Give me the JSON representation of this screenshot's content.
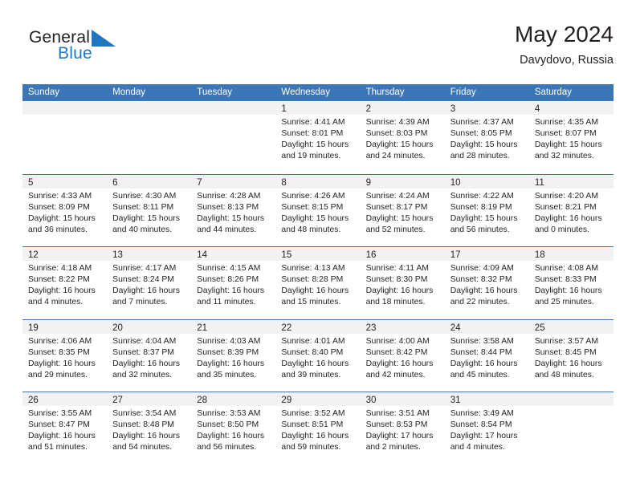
{
  "brand": {
    "line1": "General",
    "line2": "Blue",
    "mark": "triangle-logo"
  },
  "header": {
    "title": "May 2024",
    "subtitle": "Davydovo, Russia"
  },
  "colors": {
    "header_blue": "#3a76b8",
    "brand_blue": "#2077c0",
    "daynum_band": "#f2f2f2",
    "text": "#231f20"
  },
  "weekdays": [
    "Sunday",
    "Monday",
    "Tuesday",
    "Wednesday",
    "Thursday",
    "Friday",
    "Saturday"
  ],
  "weeks": [
    [
      {
        "empty": true
      },
      {
        "empty": true
      },
      {
        "empty": true
      },
      {
        "day": "1",
        "sunrise": "Sunrise: 4:41 AM",
        "sunset": "Sunset: 8:01 PM",
        "daylight1": "Daylight: 15 hours",
        "daylight2": "and 19 minutes."
      },
      {
        "day": "2",
        "sunrise": "Sunrise: 4:39 AM",
        "sunset": "Sunset: 8:03 PM",
        "daylight1": "Daylight: 15 hours",
        "daylight2": "and 24 minutes."
      },
      {
        "day": "3",
        "sunrise": "Sunrise: 4:37 AM",
        "sunset": "Sunset: 8:05 PM",
        "daylight1": "Daylight: 15 hours",
        "daylight2": "and 28 minutes."
      },
      {
        "day": "4",
        "sunrise": "Sunrise: 4:35 AM",
        "sunset": "Sunset: 8:07 PM",
        "daylight1": "Daylight: 15 hours",
        "daylight2": "and 32 minutes."
      }
    ],
    [
      {
        "day": "5",
        "sunrise": "Sunrise: 4:33 AM",
        "sunset": "Sunset: 8:09 PM",
        "daylight1": "Daylight: 15 hours",
        "daylight2": "and 36 minutes."
      },
      {
        "day": "6",
        "sunrise": "Sunrise: 4:30 AM",
        "sunset": "Sunset: 8:11 PM",
        "daylight1": "Daylight: 15 hours",
        "daylight2": "and 40 minutes."
      },
      {
        "day": "7",
        "sunrise": "Sunrise: 4:28 AM",
        "sunset": "Sunset: 8:13 PM",
        "daylight1": "Daylight: 15 hours",
        "daylight2": "and 44 minutes."
      },
      {
        "day": "8",
        "sunrise": "Sunrise: 4:26 AM",
        "sunset": "Sunset: 8:15 PM",
        "daylight1": "Daylight: 15 hours",
        "daylight2": "and 48 minutes."
      },
      {
        "day": "9",
        "sunrise": "Sunrise: 4:24 AM",
        "sunset": "Sunset: 8:17 PM",
        "daylight1": "Daylight: 15 hours",
        "daylight2": "and 52 minutes."
      },
      {
        "day": "10",
        "sunrise": "Sunrise: 4:22 AM",
        "sunset": "Sunset: 8:19 PM",
        "daylight1": "Daylight: 15 hours",
        "daylight2": "and 56 minutes."
      },
      {
        "day": "11",
        "sunrise": "Sunrise: 4:20 AM",
        "sunset": "Sunset: 8:21 PM",
        "daylight1": "Daylight: 16 hours",
        "daylight2": "and 0 minutes."
      }
    ],
    [
      {
        "day": "12",
        "sunrise": "Sunrise: 4:18 AM",
        "sunset": "Sunset: 8:22 PM",
        "daylight1": "Daylight: 16 hours",
        "daylight2": "and 4 minutes."
      },
      {
        "day": "13",
        "sunrise": "Sunrise: 4:17 AM",
        "sunset": "Sunset: 8:24 PM",
        "daylight1": "Daylight: 16 hours",
        "daylight2": "and 7 minutes."
      },
      {
        "day": "14",
        "sunrise": "Sunrise: 4:15 AM",
        "sunset": "Sunset: 8:26 PM",
        "daylight1": "Daylight: 16 hours",
        "daylight2": "and 11 minutes."
      },
      {
        "day": "15",
        "sunrise": "Sunrise: 4:13 AM",
        "sunset": "Sunset: 8:28 PM",
        "daylight1": "Daylight: 16 hours",
        "daylight2": "and 15 minutes."
      },
      {
        "day": "16",
        "sunrise": "Sunrise: 4:11 AM",
        "sunset": "Sunset: 8:30 PM",
        "daylight1": "Daylight: 16 hours",
        "daylight2": "and 18 minutes."
      },
      {
        "day": "17",
        "sunrise": "Sunrise: 4:09 AM",
        "sunset": "Sunset: 8:32 PM",
        "daylight1": "Daylight: 16 hours",
        "daylight2": "and 22 minutes."
      },
      {
        "day": "18",
        "sunrise": "Sunrise: 4:08 AM",
        "sunset": "Sunset: 8:33 PM",
        "daylight1": "Daylight: 16 hours",
        "daylight2": "and 25 minutes."
      }
    ],
    [
      {
        "day": "19",
        "sunrise": "Sunrise: 4:06 AM",
        "sunset": "Sunset: 8:35 PM",
        "daylight1": "Daylight: 16 hours",
        "daylight2": "and 29 minutes."
      },
      {
        "day": "20",
        "sunrise": "Sunrise: 4:04 AM",
        "sunset": "Sunset: 8:37 PM",
        "daylight1": "Daylight: 16 hours",
        "daylight2": "and 32 minutes."
      },
      {
        "day": "21",
        "sunrise": "Sunrise: 4:03 AM",
        "sunset": "Sunset: 8:39 PM",
        "daylight1": "Daylight: 16 hours",
        "daylight2": "and 35 minutes."
      },
      {
        "day": "22",
        "sunrise": "Sunrise: 4:01 AM",
        "sunset": "Sunset: 8:40 PM",
        "daylight1": "Daylight: 16 hours",
        "daylight2": "and 39 minutes."
      },
      {
        "day": "23",
        "sunrise": "Sunrise: 4:00 AM",
        "sunset": "Sunset: 8:42 PM",
        "daylight1": "Daylight: 16 hours",
        "daylight2": "and 42 minutes."
      },
      {
        "day": "24",
        "sunrise": "Sunrise: 3:58 AM",
        "sunset": "Sunset: 8:44 PM",
        "daylight1": "Daylight: 16 hours",
        "daylight2": "and 45 minutes."
      },
      {
        "day": "25",
        "sunrise": "Sunrise: 3:57 AM",
        "sunset": "Sunset: 8:45 PM",
        "daylight1": "Daylight: 16 hours",
        "daylight2": "and 48 minutes."
      }
    ],
    [
      {
        "day": "26",
        "sunrise": "Sunrise: 3:55 AM",
        "sunset": "Sunset: 8:47 PM",
        "daylight1": "Daylight: 16 hours",
        "daylight2": "and 51 minutes."
      },
      {
        "day": "27",
        "sunrise": "Sunrise: 3:54 AM",
        "sunset": "Sunset: 8:48 PM",
        "daylight1": "Daylight: 16 hours",
        "daylight2": "and 54 minutes."
      },
      {
        "day": "28",
        "sunrise": "Sunrise: 3:53 AM",
        "sunset": "Sunset: 8:50 PM",
        "daylight1": "Daylight: 16 hours",
        "daylight2": "and 56 minutes."
      },
      {
        "day": "29",
        "sunrise": "Sunrise: 3:52 AM",
        "sunset": "Sunset: 8:51 PM",
        "daylight1": "Daylight: 16 hours",
        "daylight2": "and 59 minutes."
      },
      {
        "day": "30",
        "sunrise": "Sunrise: 3:51 AM",
        "sunset": "Sunset: 8:53 PM",
        "daylight1": "Daylight: 17 hours",
        "daylight2": "and 2 minutes."
      },
      {
        "day": "31",
        "sunrise": "Sunrise: 3:49 AM",
        "sunset": "Sunset: 8:54 PM",
        "daylight1": "Daylight: 17 hours",
        "daylight2": "and 4 minutes."
      },
      {
        "empty": true
      }
    ]
  ]
}
